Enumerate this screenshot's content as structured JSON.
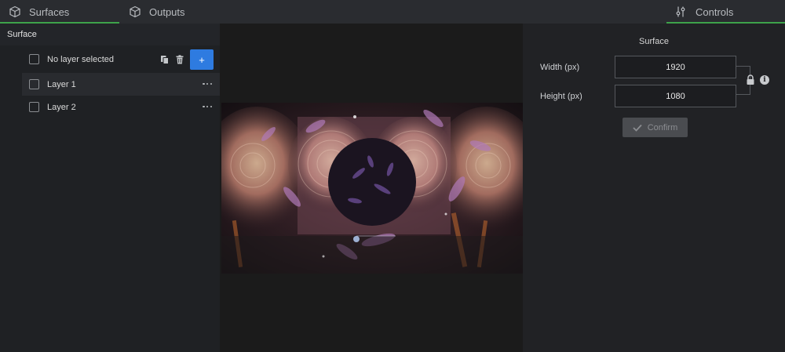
{
  "tabs": {
    "surfaces": "Surfaces",
    "outputs": "Outputs",
    "controls": "Controls"
  },
  "left_panel": {
    "header": "Surface",
    "no_layer_label": "No layer selected",
    "add_label": "+",
    "layers": [
      {
        "label": "Layer 1"
      },
      {
        "label": "Layer 2"
      }
    ]
  },
  "controls": {
    "title": "Surface",
    "width_label": "Width (px)",
    "width_value": "1920",
    "height_label": "Height (px)",
    "height_value": "1080",
    "confirm_label": "Confirm",
    "info_glyph": "i"
  },
  "colors": {
    "accent_green": "#3ea34a",
    "add_button_blue": "#2e7be0"
  },
  "icons": [
    "cube-icon",
    "sliders-icon",
    "copy-icon",
    "trash-icon",
    "plus-icon",
    "more-dots-icon",
    "lock-icon",
    "info-icon",
    "check-icon"
  ]
}
